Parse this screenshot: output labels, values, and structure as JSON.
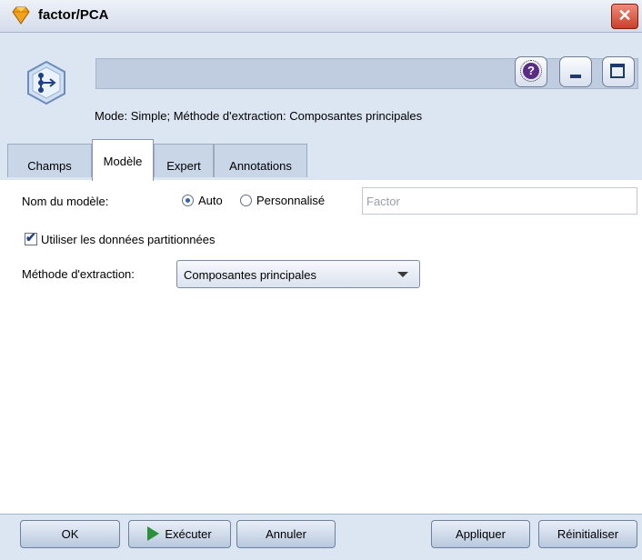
{
  "window": {
    "title": "factor/PCA",
    "close_glyph": "✕"
  },
  "header": {
    "help_glyph": "?",
    "mode_text": "Mode: Simple; Méthode d'extraction: Composantes principales"
  },
  "tabs": [
    {
      "label": "Champs",
      "active": false
    },
    {
      "label": "Modèle",
      "active": true
    },
    {
      "label": "Expert",
      "active": false
    },
    {
      "label": "Annotations",
      "active": false
    }
  ],
  "model_tab": {
    "model_name_label": "Nom du modèle:",
    "radio_auto_label": "Auto",
    "radio_custom_label": "Personnalisé",
    "radio_selected": "Auto",
    "model_name_value": "Factor",
    "partition_checkbox_label": "Utiliser les données partitionnées",
    "partition_checked": true,
    "extraction_label": "Méthode d'extraction:",
    "extraction_value": "Composantes principales"
  },
  "footer": {
    "ok": "OK",
    "execute": "Exécuter",
    "cancel": "Annuler",
    "apply": "Appliquer",
    "reset": "Réinitialiser"
  },
  "icons": {
    "title": "node-diamond-icon",
    "node": "factor-node-icon",
    "execute": "play-icon"
  },
  "colors": {
    "accent": "#2f62b8",
    "close": "#c9402b",
    "play": "#2e8f3a",
    "header_bg": "#dce5f2"
  }
}
